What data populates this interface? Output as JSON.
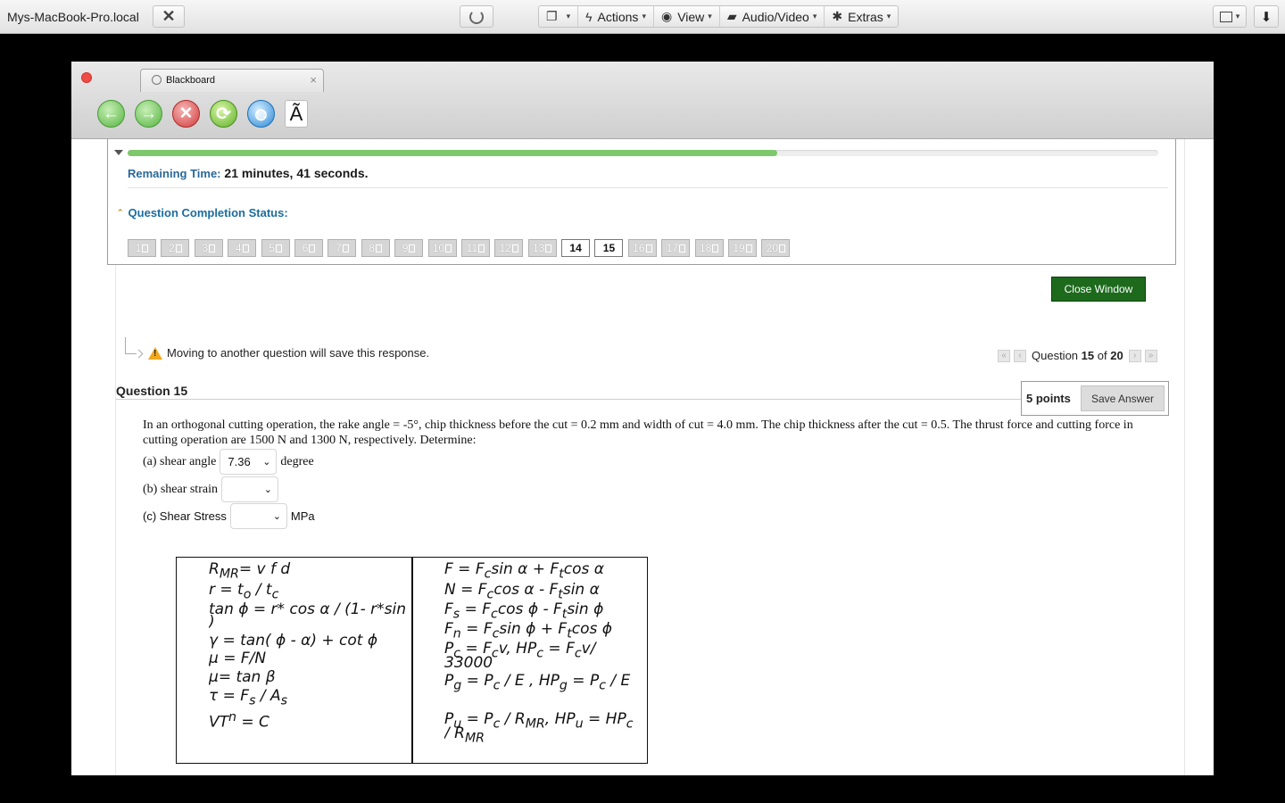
{
  "remote_toolbar": {
    "hostname": "Mys-MacBook-Pro.local",
    "menu": [
      {
        "label": "Actions",
        "icon": "lightning-icon"
      },
      {
        "label": "View",
        "icon": "eye-icon"
      },
      {
        "label": "Audio/Video",
        "icon": "chat-icon"
      },
      {
        "label": "Extras",
        "icon": "wrench-icon"
      }
    ]
  },
  "browser": {
    "tab_title": "Blackboard"
  },
  "test": {
    "progress_fraction": 0.63,
    "remaining_label": "Remaining Time:",
    "remaining_minutes": "21",
    "minutes_word": "minutes,",
    "remaining_seconds": "41",
    "seconds_word": "seconds.",
    "completion_label": "Question Completion Status:",
    "questions": [
      {
        "label": "1",
        "state": "saved"
      },
      {
        "label": "2",
        "state": "saved"
      },
      {
        "label": "3",
        "state": "saved"
      },
      {
        "label": "4",
        "state": "saved"
      },
      {
        "label": "5",
        "state": "saved"
      },
      {
        "label": "6",
        "state": "saved"
      },
      {
        "label": "7",
        "state": "saved"
      },
      {
        "label": "8",
        "state": "saved"
      },
      {
        "label": "9",
        "state": "saved"
      },
      {
        "label": "10",
        "state": "saved"
      },
      {
        "label": "11",
        "state": "saved"
      },
      {
        "label": "12",
        "state": "saved"
      },
      {
        "label": "13",
        "state": "saved"
      },
      {
        "label": "14",
        "state": "current"
      },
      {
        "label": "15",
        "state": "current"
      },
      {
        "label": "16",
        "state": "saved"
      },
      {
        "label": "17",
        "state": "saved"
      },
      {
        "label": "18",
        "state": "saved"
      },
      {
        "label": "19",
        "state": "saved"
      },
      {
        "label": "20",
        "state": "saved"
      }
    ],
    "close_window_label": "Close Window",
    "warning": "Moving to another question will save this response.",
    "pager_prefix": "Question",
    "pager_current": "15",
    "pager_of": "of",
    "pager_total": "20"
  },
  "question": {
    "title": "Question 15",
    "points": "5 points",
    "save_label": "Save Answer",
    "text": "In an orthogonal cutting operation, the rake angle = -5°, chip thickness before the cut = 0.2 mm and width of cut = 4.0 mm. The chip thickness after the cut = 0.5. The thrust force and cutting force in cutting operation are 1500 N and 1300 N, respectively. Determine:",
    "parts": [
      {
        "label": "(a) shear angle",
        "value": "7.36",
        "unit": "degree"
      },
      {
        "label": "(b) shear strain",
        "value": "",
        "unit": ""
      },
      {
        "label": "(c) Shear Stress",
        "value": "",
        "unit": "MPa"
      }
    ]
  },
  "formulas": {
    "left": {
      "l1": {
        "a": "R",
        "b": "MR",
        "c": "= v f d"
      },
      "l2": {
        "a": "r = t",
        "b": "o",
        "c": " / t",
        "d": "c"
      },
      "l3": "tan ϕ = r* cos α / (1- r*sin α",
      "l3b": ")",
      "l4": "γ = tan( ϕ - α) + cot ϕ",
      "l5": "μ = F/N",
      "l6": "μ= tan β",
      "l7": {
        "a": "τ = F",
        "b": "s",
        "c": " / A",
        "d": "s"
      },
      "l8": {
        "a": "VT",
        "b": "n",
        "c": " = C"
      }
    },
    "right": {
      "r1": {
        "a": "F = F",
        "b": "c",
        "c": "sin α + F",
        "d": "t",
        "e": "cos α"
      },
      "r2": {
        "a": "N = F",
        "b": "c",
        "c": "cos α - F",
        "d": "t",
        "e": "sin α"
      },
      "r3": {
        "a": "F",
        "b": "s",
        "c": " = F",
        "d": "c",
        "e": "cos ϕ - F",
        "f": "t",
        "g": "sin ϕ"
      },
      "r4": {
        "a": "F",
        "b": "n",
        "c": " = F",
        "d": "c",
        "e": "sin ϕ + F",
        "f": "t",
        "g": "cos ϕ"
      },
      "r5": {
        "a": "P",
        "b": "c",
        "c": " = F",
        "d": "c",
        "e": "v, HP",
        "f": "c",
        "g": " = F",
        "h": "c",
        "i": "v/"
      },
      "r5b": "33000",
      "r6": {
        "a": "P",
        "b": "g",
        "c": " = P",
        "d": "c",
        "e": " / E , HP",
        "f": "g",
        "g": " = P",
        "h": "c",
        "i": " / E"
      },
      "r7": {
        "a": "P",
        "b": "u",
        "c": " = P",
        "d": "c",
        "e": " / R",
        "f": "MR",
        "g": ", HP",
        "h": "u",
        "i": " = HP",
        "j": "c"
      },
      "r7b": {
        "a": "/ R",
        "b": "MR"
      }
    }
  }
}
